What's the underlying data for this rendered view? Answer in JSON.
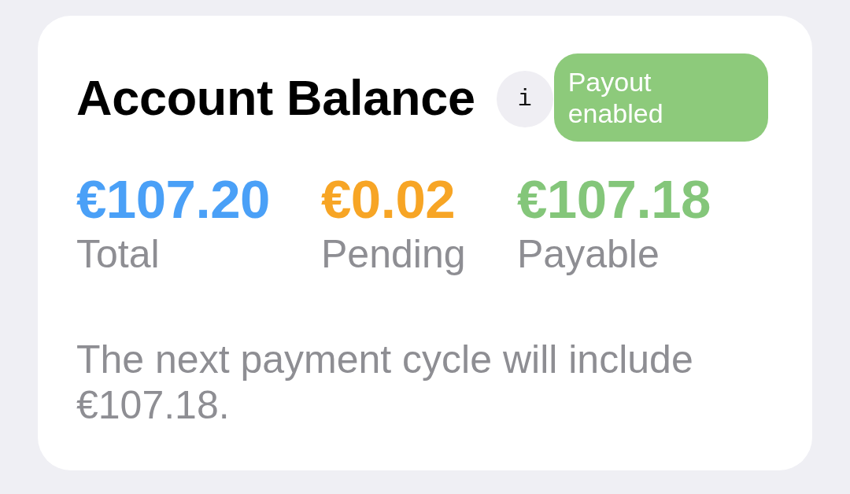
{
  "card": {
    "title": "Account Balance",
    "info_button": {
      "label": "i"
    },
    "payout_badge": {
      "label": "Payout enabled",
      "enabled": true
    },
    "balances": [
      {
        "amount": "€107.20",
        "label": "Total",
        "color": "#4aa0f7"
      },
      {
        "amount": "€0.02",
        "label": "Pending",
        "color": "#f7a525"
      },
      {
        "amount": "€107.18",
        "label": "Payable",
        "color": "#84c67a"
      }
    ],
    "note": "The next payment cycle will include €107.18."
  }
}
